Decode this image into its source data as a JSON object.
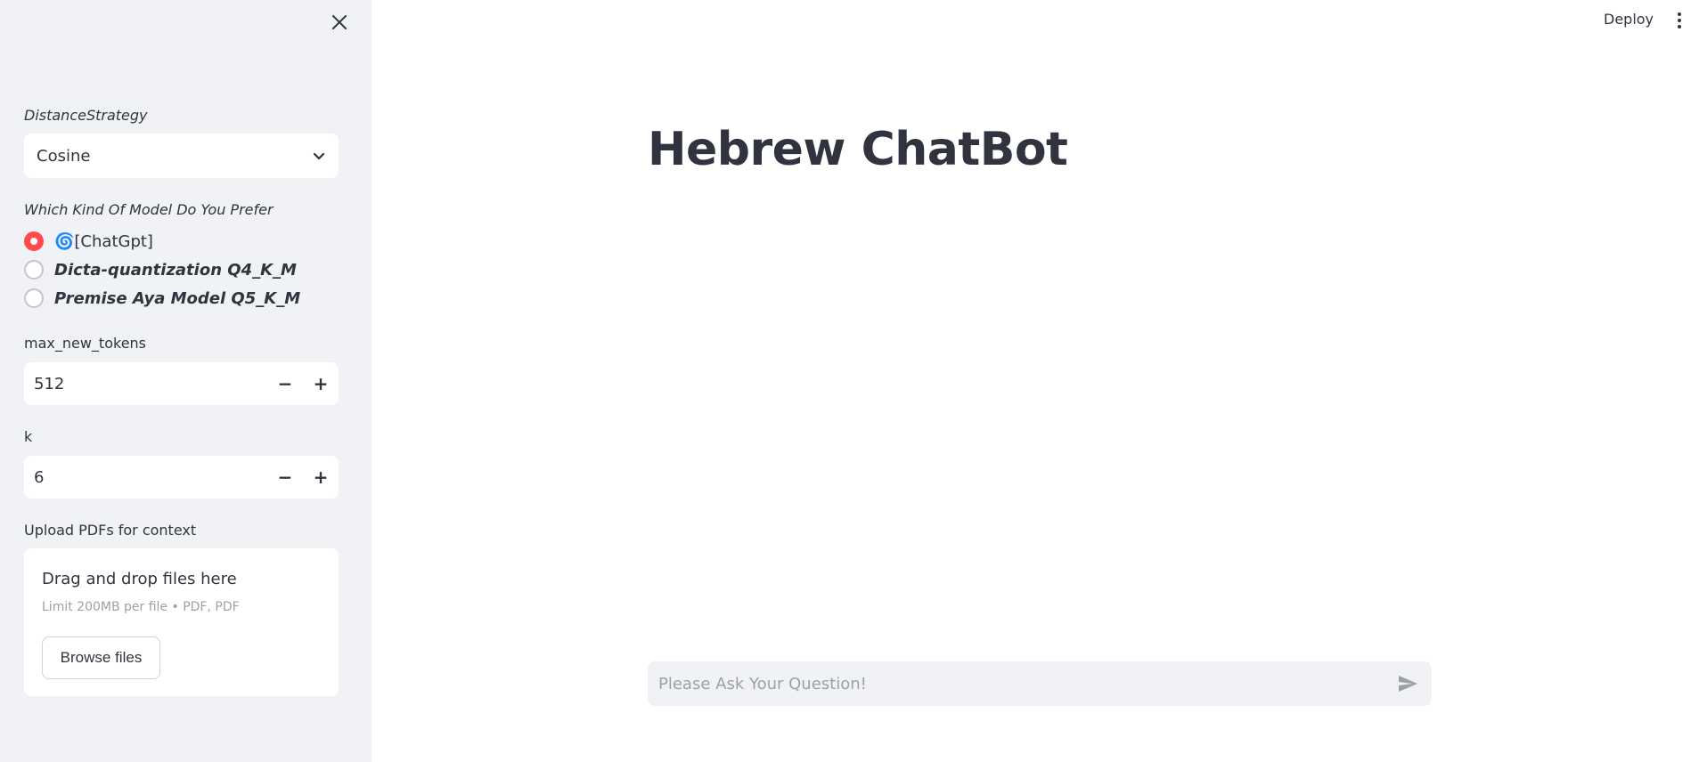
{
  "header": {
    "deploy_label": "Deploy"
  },
  "sidebar": {
    "distance_label": "DistanceStrategy",
    "distance_value": "Cosine",
    "model_label": "Which Kind Of Model Do You Prefer",
    "models": [
      {
        "label": "🌀[ChatGpt]",
        "selected": true
      },
      {
        "label": "Dicta-quantization Q4_K_M",
        "selected": false
      },
      {
        "label": "Premise Aya Model Q5_K_M",
        "selected": false
      }
    ],
    "max_tokens_label": "max_new_tokens",
    "max_tokens_value": "512",
    "k_label": "k",
    "k_value": "6",
    "upload_label": "Upload PDFs for context",
    "upload_drag_text": "Drag and drop files here",
    "upload_limit_text": "Limit 200MB per file • PDF, PDF",
    "browse_label": "Browse files"
  },
  "main": {
    "title": "Hebrew ChatBot",
    "chat_placeholder": "Please Ask Your Question!"
  },
  "colors": {
    "accent": "#ff4b4b",
    "sidebar_bg": "#f0f2f6",
    "text": "#31333f"
  }
}
